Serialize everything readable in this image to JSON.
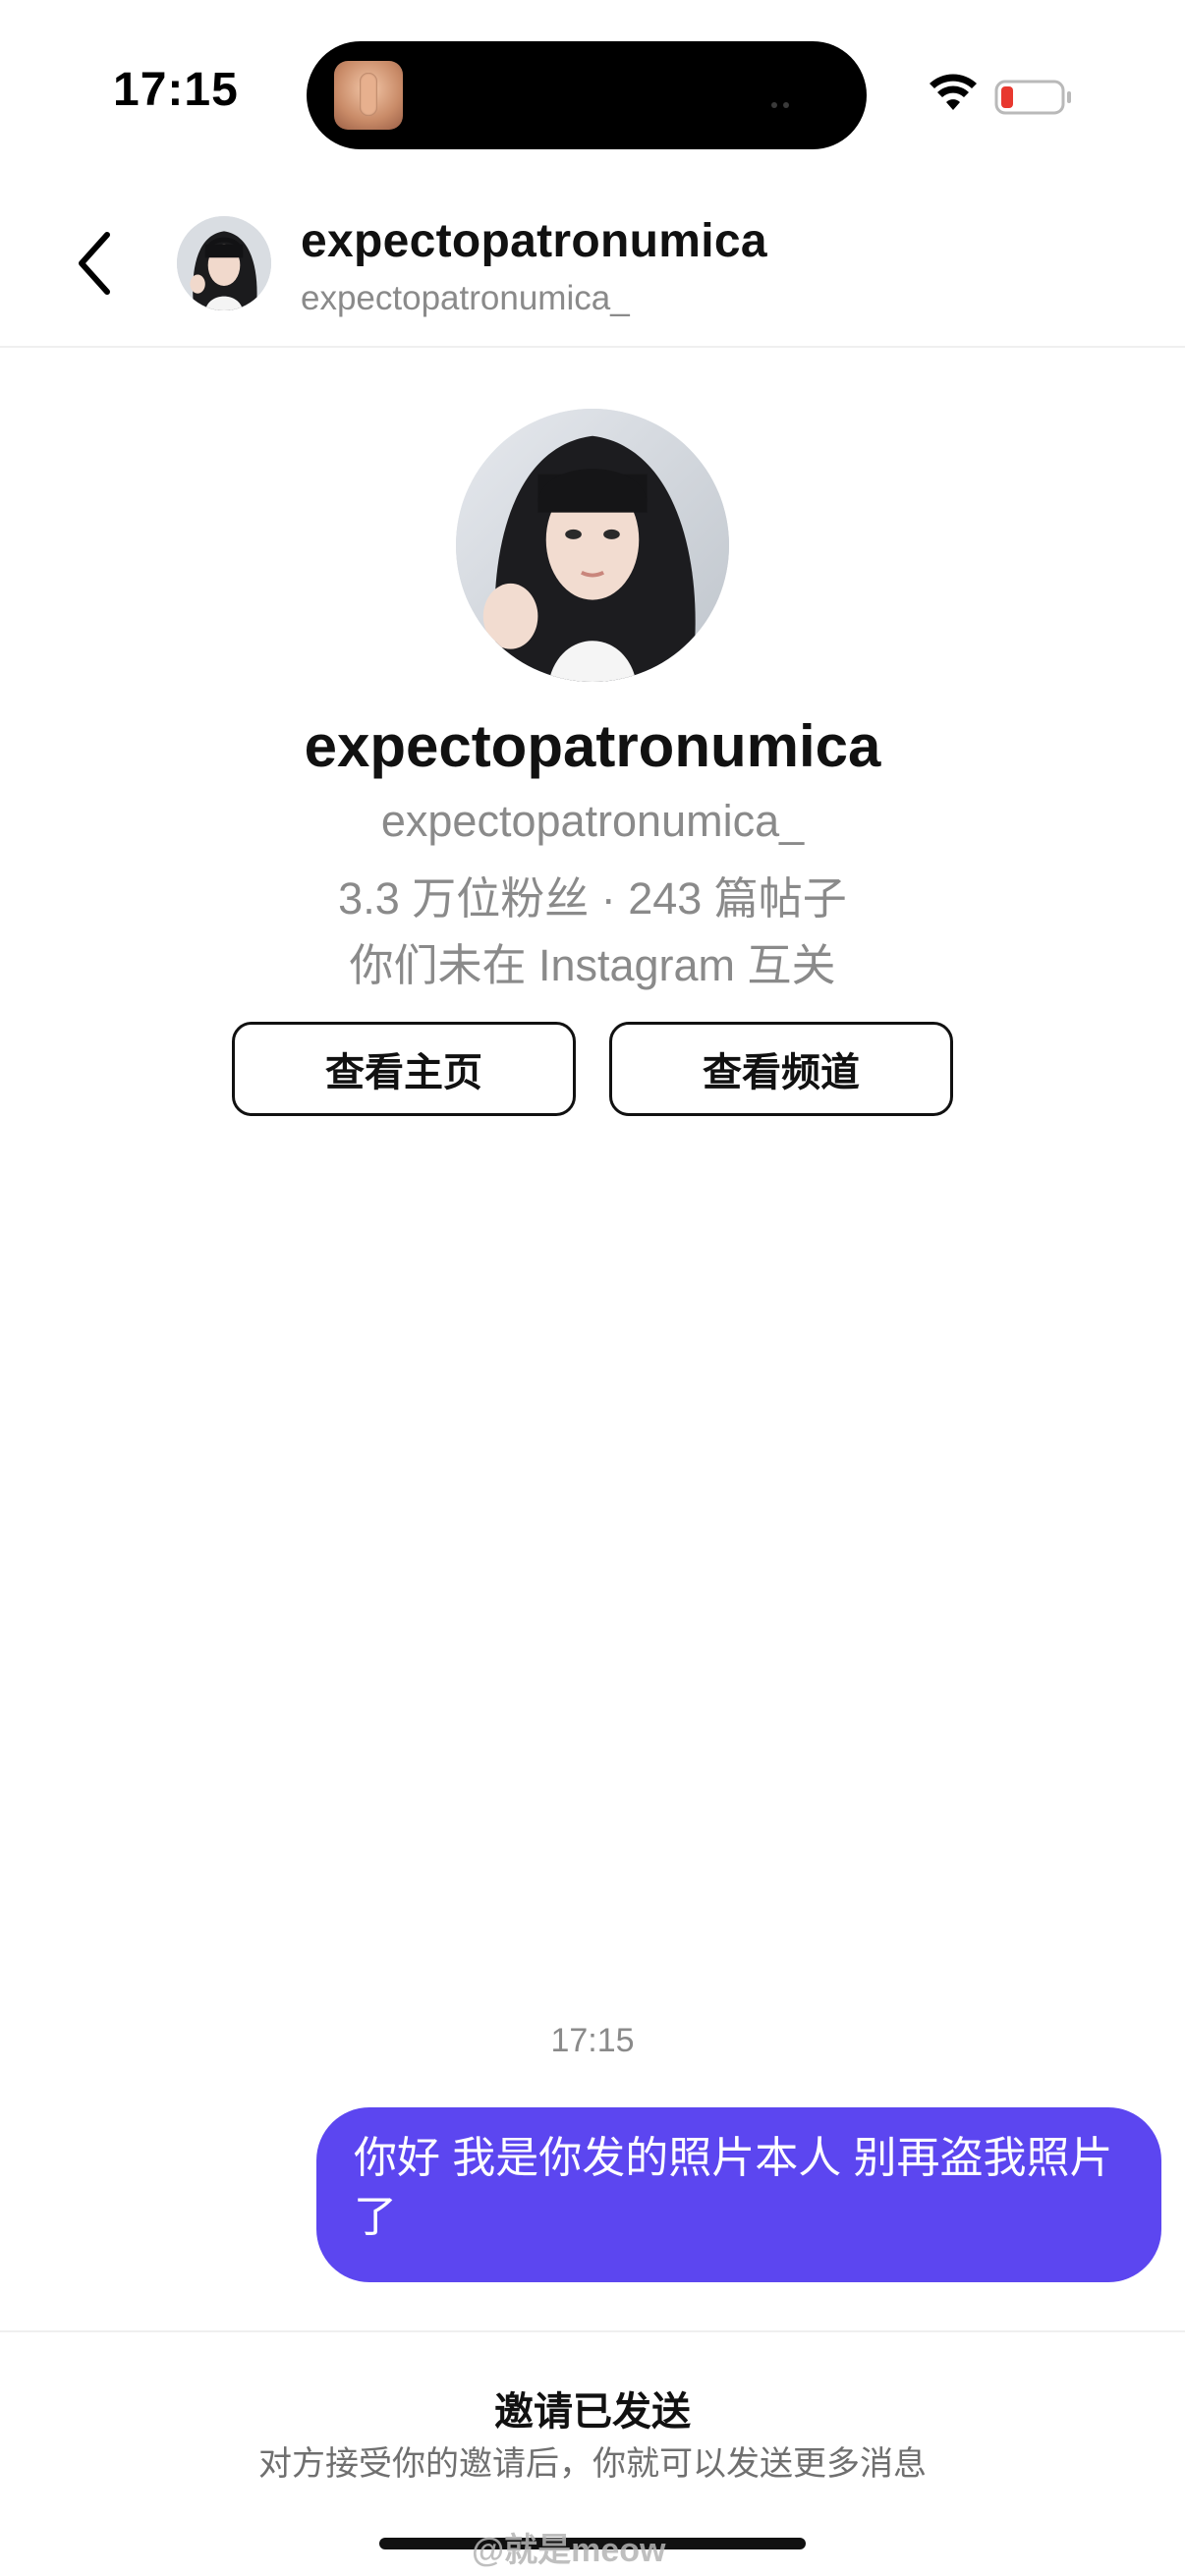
{
  "status_bar": {
    "time": "17:15",
    "icons": [
      "wifi-icon",
      "battery-low-icon"
    ],
    "battery_color": "#e8382f"
  },
  "header": {
    "display_name": "expectopatronumica",
    "handle": "expectopatronumica_",
    "back_icon": "chevron-left-icon"
  },
  "profile": {
    "display_name": "expectopatronumica",
    "handle": "expectopatronumica_",
    "stats": "3.3 万位粉丝 · 243 篇帖子",
    "mutual_note": "你们未在 Instagram 互关",
    "buttons": {
      "view_profile": "查看主页",
      "view_channel": "查看频道"
    }
  },
  "chat": {
    "timestamp": "17:15",
    "messages": [
      {
        "direction": "outgoing",
        "text": "你好 我是你发的照片本人 别再盗我照片了"
      }
    ],
    "bubble_color": "#5c46f0"
  },
  "footer": {
    "invite_title": "邀请已发送",
    "invite_subtitle": "对方接受你的邀请后，你就可以发送更多消息"
  },
  "watermark": "@就是meow"
}
